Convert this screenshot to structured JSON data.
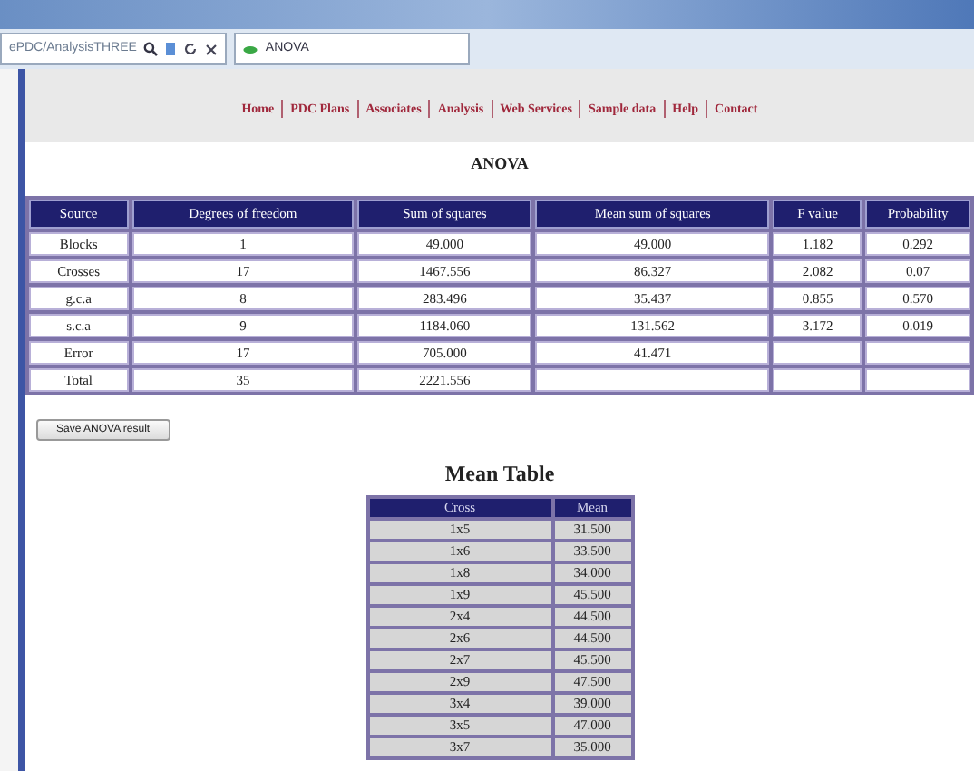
{
  "browser": {
    "address": "ePDC/AnalysisTHREE",
    "tab_title": "ANOVA"
  },
  "nav": [
    "Home",
    "PDC Plans",
    "Associates",
    "Analysis",
    "Web Services",
    "Sample data",
    "Help",
    "Contact"
  ],
  "title": "ANOVA",
  "anova_table": {
    "columns": [
      "Source",
      "Degrees of freedom",
      "Sum of squares",
      "Mean sum of squares",
      "F value",
      "Probability"
    ],
    "rows": [
      [
        "Blocks",
        "1",
        "49.000",
        "49.000",
        "1.182",
        "0.292"
      ],
      [
        "Crosses",
        "17",
        "1467.556",
        "86.327",
        "2.082",
        "0.07"
      ],
      [
        "g.c.a",
        "8",
        "283.496",
        "35.437",
        "0.855",
        "0.570"
      ],
      [
        "s.c.a",
        "9",
        "1184.060",
        "131.562",
        "3.172",
        "0.019"
      ],
      [
        "Error",
        "17",
        "705.000",
        "41.471",
        "",
        ""
      ],
      [
        "Total",
        "35",
        "2221.556",
        "",
        "",
        ""
      ]
    ]
  },
  "save_button": "Save ANOVA result",
  "mean_table": {
    "title": "Mean Table",
    "columns": [
      "Cross",
      "Mean"
    ],
    "rows": [
      [
        "1x5",
        "31.500"
      ],
      [
        "1x6",
        "33.500"
      ],
      [
        "1x8",
        "34.000"
      ],
      [
        "1x9",
        "45.500"
      ],
      [
        "2x4",
        "44.500"
      ],
      [
        "2x6",
        "44.500"
      ],
      [
        "2x7",
        "45.500"
      ],
      [
        "2x9",
        "47.500"
      ],
      [
        "3x4",
        "39.000"
      ],
      [
        "3x5",
        "47.000"
      ],
      [
        "3x7",
        "35.000"
      ]
    ]
  }
}
